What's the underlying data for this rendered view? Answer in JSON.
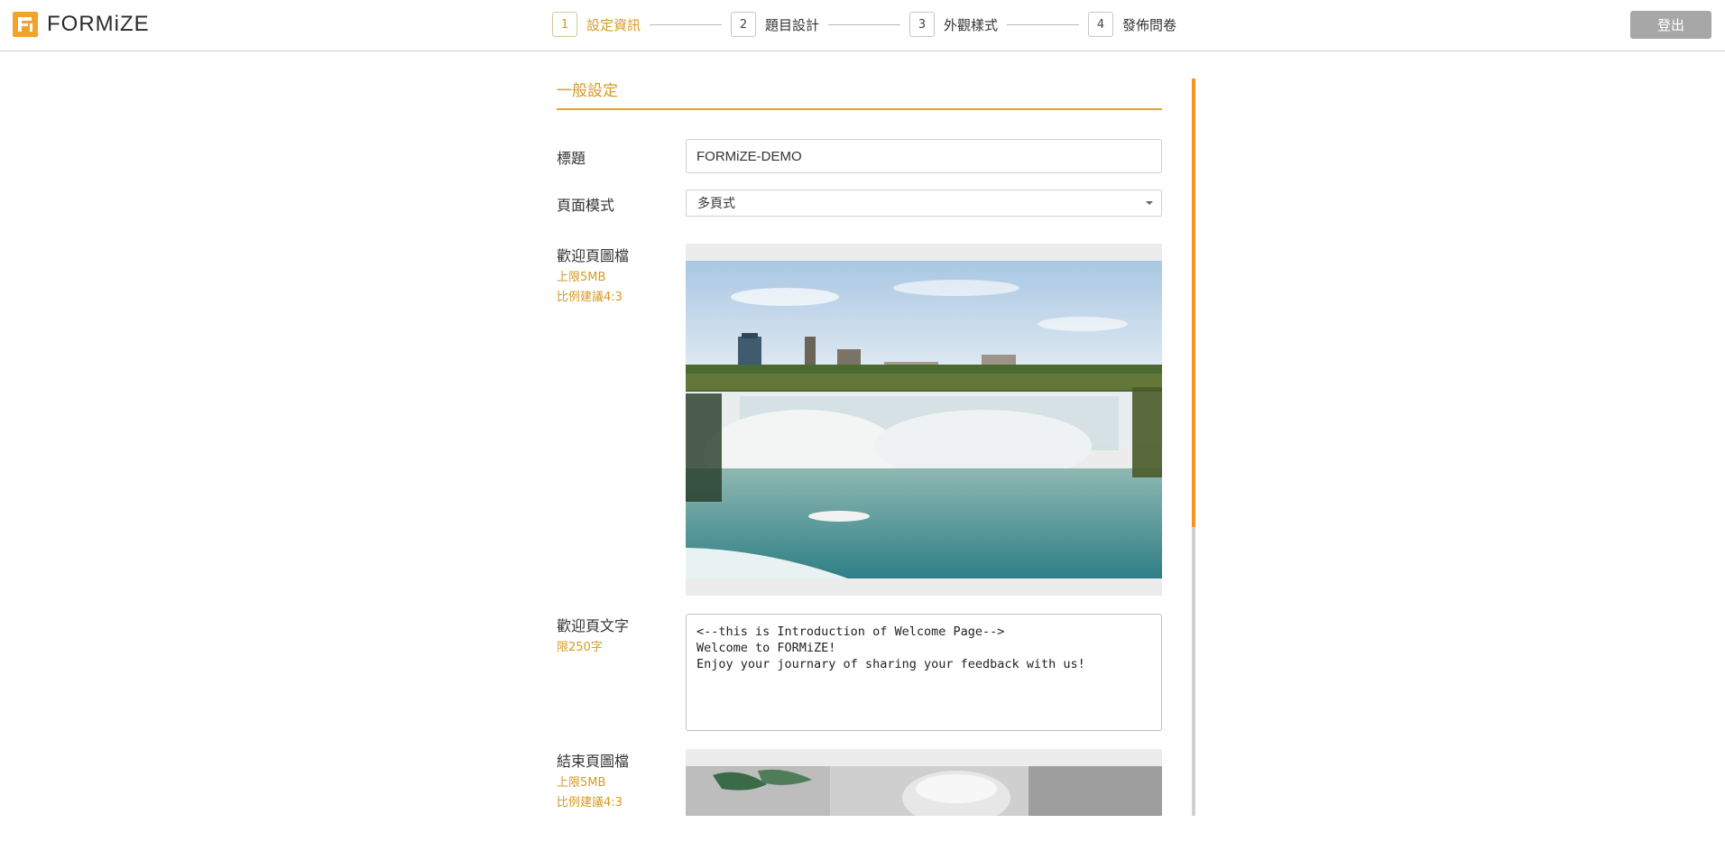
{
  "app": {
    "logo_text": "FORMiZE"
  },
  "steps": [
    {
      "num": "1",
      "label": "設定資訊",
      "active": true
    },
    {
      "num": "2",
      "label": "題目設計"
    },
    {
      "num": "3",
      "label": "外觀樣式"
    },
    {
      "num": "4",
      "label": "發佈問卷"
    }
  ],
  "header": {
    "logout_label": "登出"
  },
  "section": {
    "title": "一般設定"
  },
  "form": {
    "title_label": "標題",
    "title_value": "FORMiZE-DEMO",
    "mode_label": "頁面模式",
    "mode_value": "多頁式",
    "welcome_image_label": "歡迎頁圖檔",
    "welcome_image_limit": "上限5MB",
    "welcome_image_ratio": "比例建議4:3",
    "welcome_text_label": "歡迎頁文字",
    "welcome_text_limit": "限250字",
    "welcome_text_value": "<--this is Introduction of Welcome Page-->\nWelcome to FORMiZE!\nEnjoy your journary of sharing your feedback with us!",
    "end_image_label": "結束頁圖檔",
    "end_image_limit": "上限5MB",
    "end_image_ratio": "比例建議4:3"
  },
  "colors": {
    "accent": "#d49a25",
    "scroll_thumb": "#f7931e",
    "logout_bg": "#a7a7a7"
  }
}
